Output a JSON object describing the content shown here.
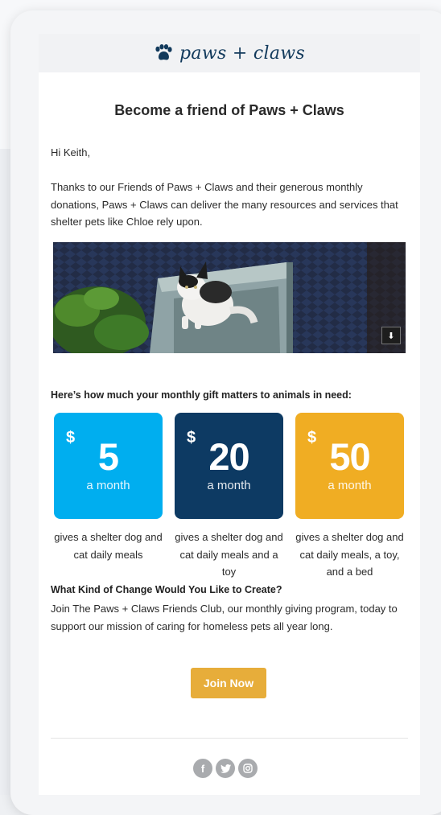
{
  "brand": {
    "name": "paws + claws",
    "color": "#123a5c"
  },
  "email": {
    "title": "Become a friend of Paws + Claws",
    "greeting": "Hi Keith,",
    "intro": "Thanks to our Friends of Paws + Claws and their generous monthly donations, Paws + Claws can deliver the many resources and services that shelter pets like Chloe rely upon.",
    "hero_icon": "download-icon",
    "subhead": "Here’s how much your monthly gift matters to animals in need:",
    "tiers": [
      {
        "currency": "$",
        "amount": "5",
        "period": "a month",
        "color": "#00aeef",
        "desc": "gives a shelter dog and cat daily meals"
      },
      {
        "currency": "$",
        "amount": "20",
        "period": "a month",
        "color": "#0d3a63",
        "desc": "gives a shelter dog and cat daily meals and a toy"
      },
      {
        "currency": "$",
        "amount": "50",
        "period": "a month",
        "color": "#f0ad23",
        "desc": "gives a shelter dog and cat daily meals, a toy, and a bed"
      }
    ],
    "cta_heading": "What Kind of Change Would You Like to Create?",
    "cta_body": "Join The Paws + Claws Friends Club, our monthly giving program, today to support our mission of caring for homeless pets all year long.",
    "join_label": "Join Now",
    "join_color": "#e7ad3a",
    "social": [
      {
        "icon": "facebook-icon",
        "glyph": "f"
      },
      {
        "icon": "twitter-icon",
        "glyph": "t"
      },
      {
        "icon": "instagram-icon",
        "glyph": "◎"
      }
    ]
  }
}
